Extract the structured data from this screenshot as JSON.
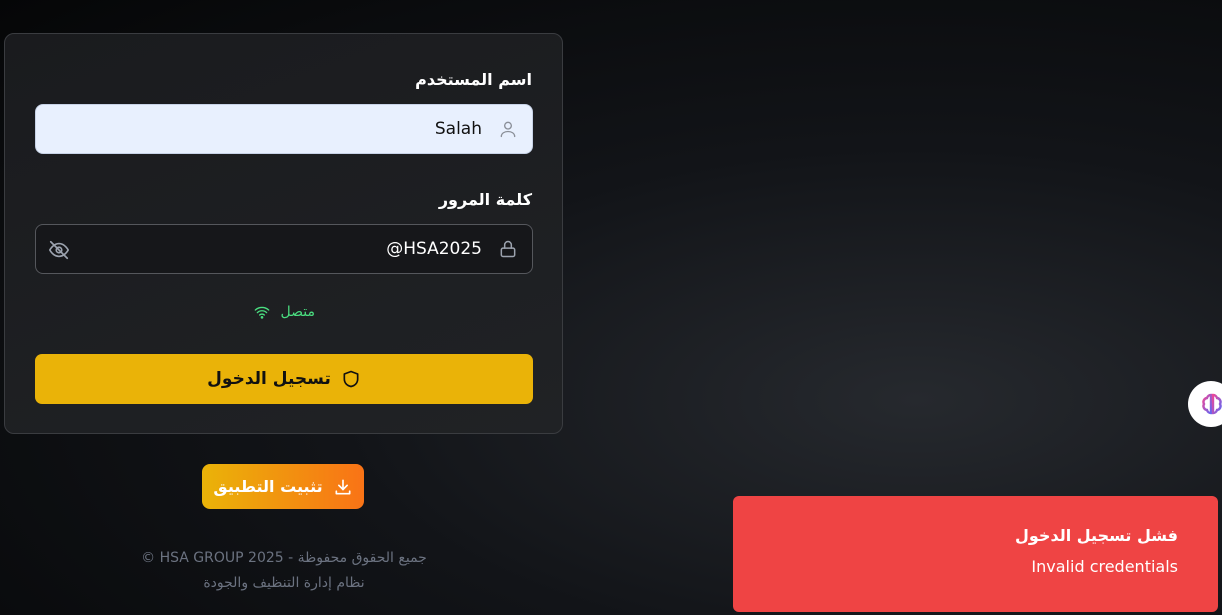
{
  "form": {
    "username_label": "اسم المستخدم",
    "username_value": "Salah",
    "password_label": "كلمة المرور",
    "password_value": "@HSA2025",
    "connection_status": "متصل",
    "login_button": "تسجيل الدخول"
  },
  "install_button": "تثبيت التطبيق",
  "footer": {
    "line1": "© HSA GROUP 2025 - جميع الحقوق محفوظة",
    "line2": "نظام إدارة التنظيف والجودة"
  },
  "toast": {
    "title": "فشل تسجيل الدخول",
    "message": "Invalid credentials"
  },
  "colors": {
    "accent": "#eab308",
    "status": "#4ade80",
    "error": "#ef4444"
  },
  "icons": [
    "user-icon",
    "lock-icon",
    "eye-off-icon",
    "wifi-icon",
    "shield-icon",
    "download-icon",
    "brain-icon"
  ]
}
